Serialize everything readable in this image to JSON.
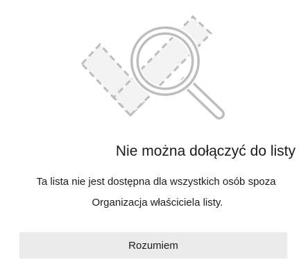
{
  "dialog": {
    "title": "Nie można dołączyć do listy",
    "message_line1": "Ta lista nie jest dostępna dla wszystkich osób spoza",
    "message_line2": "Organizacja właściciela listy.",
    "button_label": "Rozumiem",
    "illustration_icon": "dashed-check-with-magnifier-icon"
  },
  "colors": {
    "text": "#1b1b1b",
    "button_bg": "#ebebeb",
    "illustration_stroke": "#bdbdbd",
    "illustration_fill": "#f3f3f3"
  }
}
